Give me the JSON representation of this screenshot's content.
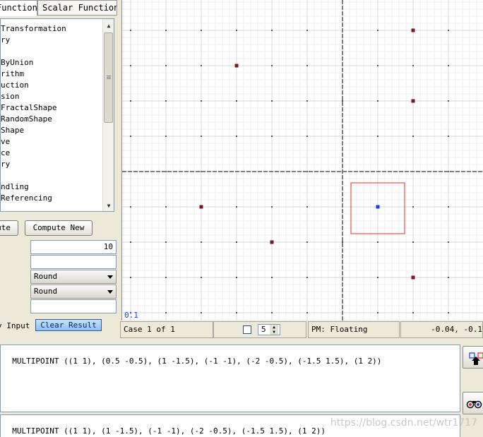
{
  "tabs": {
    "functions": "Functions",
    "scalar": "Scalar Functions"
  },
  "function_list": [
    "Transformation",
    "ry",
    "",
    "ByUnion",
    "rithm",
    "uction",
    "sion",
    "FractalShape",
    "RandomShape",
    "Shape",
    "ve",
    "ce",
    "ry",
    "",
    "ndling",
    "Referencing"
  ],
  "buttons": {
    "execute": "Execute",
    "compute_new": "Compute New",
    "clear_result": "Clear Result"
  },
  "params": {
    "value": "10",
    "empty1": "",
    "round1": "Round",
    "round2": "Round",
    "empty2": ""
  },
  "labels": {
    "by_input": "y Input"
  },
  "canvas": {
    "scale_label": "0.1",
    "colors": {
      "point_a": "#7b1425",
      "point_b": "#1a3fe0",
      "selection": "#e0302a",
      "axis": "#7f7f7f",
      "grid_minor": "#eeeeee",
      "grid_major": "#d4d4d4"
    },
    "points_a": [
      [
        1,
        1
      ],
      [
        1,
        -1.5
      ],
      [
        -1,
        -1
      ],
      [
        -2,
        -0.5
      ],
      [
        -1.5,
        1.5
      ],
      [
        1,
        2
      ]
    ],
    "points_b": [
      [
        0.5,
        -0.5
      ]
    ]
  },
  "status_bar": {
    "case": "Case 1 of 1",
    "spin_value": "5",
    "pm": "PM: Floating",
    "coords": "-0.04, -0.1"
  },
  "result_a": "MULTIPOINT ((1 1), (0.5 -0.5), (1 -1.5), (-1 -1), (-2 -0.5), (-1.5 1.5), (1 2))",
  "result_b": "MULTIPOINT ((1 1), (1 -1.5), (-1 -1), (-2 -0.5), (-1.5 1.5), (1 2))",
  "watermark": "https://blog.csdn.net/wtr1717"
}
